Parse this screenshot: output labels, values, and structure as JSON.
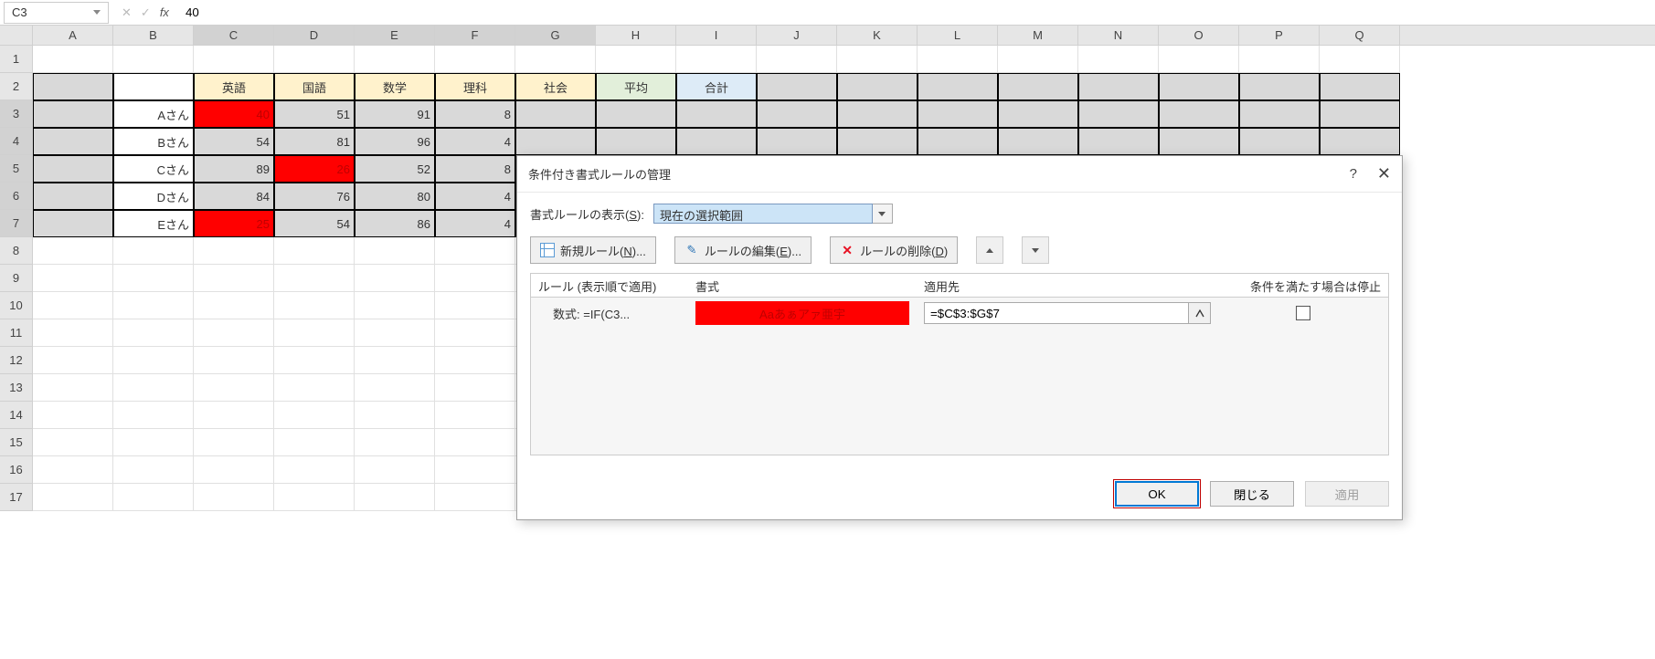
{
  "namebox": "C3",
  "formula_value": "40",
  "columns": [
    "A",
    "B",
    "C",
    "D",
    "E",
    "F",
    "G",
    "H",
    "I",
    "J",
    "K",
    "L",
    "M",
    "N",
    "O",
    "P",
    "Q"
  ],
  "row_numbers": [
    1,
    2,
    3,
    4,
    5,
    6,
    7,
    8,
    9,
    10,
    11,
    12,
    13,
    14,
    15,
    16,
    17
  ],
  "selected_rows": [
    3,
    4,
    5,
    6,
    7
  ],
  "selected_cols": [
    "C",
    "D",
    "E",
    "F",
    "G"
  ],
  "headers": {
    "subjects": [
      "英語",
      "国語",
      "数学",
      "理科",
      "社会"
    ],
    "avg": "平均",
    "total": "合計"
  },
  "students": [
    {
      "name": "Aさん",
      "scores": [
        40,
        51,
        91,
        "8"
      ],
      "red": [
        0
      ]
    },
    {
      "name": "Bさん",
      "scores": [
        54,
        81,
        96,
        "4"
      ],
      "red": []
    },
    {
      "name": "Cさん",
      "scores": [
        89,
        26,
        52,
        "8"
      ],
      "red": [
        1
      ]
    },
    {
      "name": "Dさん",
      "scores": [
        84,
        76,
        80,
        "4"
      ],
      "red": []
    },
    {
      "name": "Eさん",
      "scores": [
        25,
        54,
        86,
        "4"
      ],
      "red": [
        0
      ]
    }
  ],
  "dialog": {
    "title": "条件付き書式ルールの管理",
    "help": "?",
    "close": "✕",
    "show_label_pre": "書式ルールの表示(",
    "show_label_s": "S",
    "show_label_post": "):",
    "scope": "現在の選択範囲",
    "new_rule_pre": "新規ルール(",
    "new_rule_u": "N",
    "new_rule_post": ")...",
    "edit_rule_pre": "ルールの編集(",
    "edit_rule_u": "E",
    "edit_rule_post": ")...",
    "del_rule_pre": "ルールの削除(",
    "del_rule_u": "D",
    "del_rule_post": ")",
    "col_rule": "ルール (表示順で適用)",
    "col_format": "書式",
    "col_applies": "適用先",
    "col_stop": "条件を満たす場合は停止",
    "rule_text": "数式: =IF(C3...",
    "preview_text": "Aaあぁアァ亜宇",
    "applies_to": "=$C$3:$G$7",
    "ok": "OK",
    "close_btn": "閉じる",
    "apply": "適用"
  }
}
